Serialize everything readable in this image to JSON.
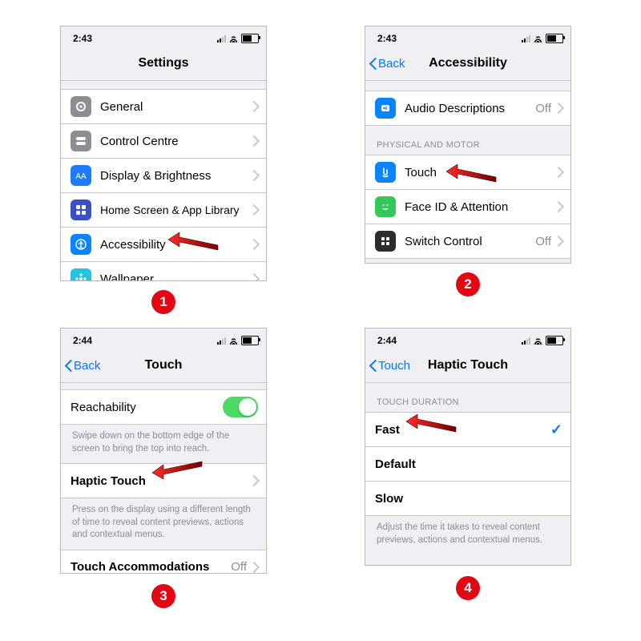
{
  "panels": {
    "p1": {
      "badge": "1",
      "status_time": "2:43",
      "title": "Settings",
      "rows": [
        {
          "label": "General"
        },
        {
          "label": "Control Centre"
        },
        {
          "label": "Display & Brightness"
        },
        {
          "label": "Home Screen & App Library"
        },
        {
          "label": "Accessibility"
        },
        {
          "label": "Wallpaper"
        }
      ]
    },
    "p2": {
      "badge": "2",
      "status_time": "2:43",
      "back": "Back",
      "title": "Accessibility",
      "top_row": {
        "label": "Audio Descriptions",
        "value": "Off"
      },
      "section_header": "PHYSICAL AND MOTOR",
      "rows": [
        {
          "label": "Touch"
        },
        {
          "label": "Face ID & Attention"
        },
        {
          "label": "Switch Control",
          "value": "Off"
        }
      ]
    },
    "p3": {
      "badge": "3",
      "status_time": "2:44",
      "back": "Back",
      "title": "Touch",
      "reach": {
        "label": "Reachability"
      },
      "reach_foot": "Swipe down on the bottom edge of the screen to bring the top into reach.",
      "haptic": {
        "label": "Haptic Touch"
      },
      "haptic_foot": "Press on the display using a different length of time to reveal content previews, actions and contextual menus.",
      "accomm": {
        "label": "Touch Accommodations",
        "value": "Off"
      }
    },
    "p4": {
      "badge": "4",
      "status_time": "2:44",
      "back": "Touch",
      "title": "Haptic Touch",
      "section_header": "TOUCH DURATION",
      "options": [
        {
          "label": "Fast",
          "selected": true
        },
        {
          "label": "Default"
        },
        {
          "label": "Slow"
        }
      ],
      "foot": "Adjust the time it takes to reveal content previews, actions and contextual menus."
    }
  }
}
